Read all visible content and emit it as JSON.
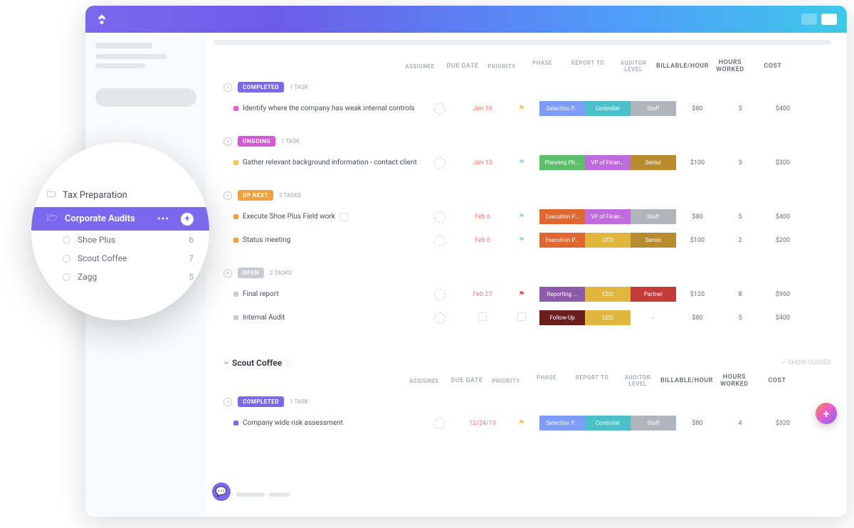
{
  "sidebar_float": {
    "folders": [
      {
        "name": "Tax Preparation"
      },
      {
        "name": "Corporate Audits",
        "active": true,
        "lists": [
          {
            "name": "Shoe Plus",
            "count": 6
          },
          {
            "name": "Scout Coffee",
            "count": 7
          },
          {
            "name": "Zagg",
            "count": 5
          }
        ]
      }
    ]
  },
  "columns": {
    "assignee": "ASSIGNEE",
    "due_date": "DUE DATE",
    "priority": "PRIORITY",
    "phase": "PHASE",
    "report_to": "REPORT TO",
    "auditor_level": "AUDITOR LEVEL",
    "billable_hour": "BILLABLE/HOUR",
    "hours_worked": "HOURS WORKED",
    "cost": "COST"
  },
  "show_closed": "SHOW CLOSED",
  "groups": [
    {
      "status": "COMPLETED",
      "status_color": "#7b68ee",
      "meta": "1 TASK",
      "tasks": [
        {
          "title": "Identify where the company has weak internal controls",
          "priority_dot": "#e65bd6",
          "date": "Jan 10",
          "date_color": "#fd7171",
          "flag": "#f2c94c",
          "phase": "Selection P...",
          "phase_c": "#7c9cf7",
          "report": "Controller",
          "report_c": "#4cc0c8",
          "level": "Staff",
          "level_c": "#b0b4bb",
          "bill": "$80",
          "hours": "5",
          "cost": "$400"
        }
      ]
    },
    {
      "status": "ONGOING",
      "status_color": "#d459d4",
      "meta": "1 TASK",
      "tasks": [
        {
          "title": "Gather relevant background information - contact client",
          "priority_dot": "#f2c94c",
          "date": "Jan 15",
          "date_color": "#fd7171",
          "flag": "#9cd6f4",
          "phase": "Planning Ph...",
          "phase_c": "#5cc06a",
          "report": "VP of Finan...",
          "report_c": "#c06ae0",
          "level": "Senior",
          "level_c": "#b88b2f",
          "bill": "$100",
          "hours": "3",
          "cost": "$300"
        }
      ]
    },
    {
      "status": "UP NEXT",
      "status_color": "#f2a23c",
      "meta": "2 TASKS",
      "tasks": [
        {
          "title": "Execute Shoe Plus Field work",
          "priority_dot": "#f2a23c",
          "date": "Feb 6",
          "date_color": "#fd7171",
          "flag": "#9cd6f4",
          "ghost": true,
          "phase": "Execution P...",
          "phase_c": "#e0672f",
          "report": "VP of Finan...",
          "report_c": "#c06ae0",
          "level": "Staff",
          "level_c": "#b0b4bb",
          "bill": "$80",
          "hours": "5",
          "cost": "$400"
        },
        {
          "title": "Status meeting",
          "priority_dot": "#f2a23c",
          "date": "Feb 6",
          "date_color": "#fd7171",
          "flag": "#9cd6f4",
          "phase": "Execution P...",
          "phase_c": "#e0672f",
          "report": "CFO",
          "report_c": "#e0b63c",
          "level": "Senior",
          "level_c": "#b88b2f",
          "bill": "$100",
          "hours": "2",
          "cost": "$200"
        }
      ]
    },
    {
      "status": "OPEN",
      "status_color": "#c8cbd2",
      "meta": "2 TASKS",
      "tasks": [
        {
          "title": "Final report",
          "priority_dot": "#c8cbd2",
          "date": "Feb 27",
          "date_color": "#fd7171",
          "flag": "#e05555",
          "phase": "Reporting ...",
          "phase_c": "#8b5aa8",
          "report": "CEO",
          "report_c": "#e0b63c",
          "level": "Partner",
          "level_c": "#c23c3c",
          "bill": "$120",
          "hours": "8",
          "cost": "$960"
        },
        {
          "title": "Internal Audit",
          "priority_dot": "#c8cbd2",
          "date": "",
          "date_color": "",
          "flag": "",
          "phase": "Follow-Up",
          "phase_c": "#6b1e1e",
          "report": "CEO",
          "report_c": "#e0b63c",
          "level": "-",
          "level_c": "transparent",
          "bill": "$80",
          "hours": "5",
          "cost": "$400"
        }
      ]
    }
  ],
  "section2": {
    "name": "Scout Coffee",
    "groups": [
      {
        "status": "COMPLETED",
        "status_color": "#7b68ee",
        "meta": "1 TASK",
        "tasks": [
          {
            "title": "Company wide risk assessment",
            "priority_dot": "#7b68ee",
            "date": "12/24/19",
            "date_color": "#fd7171",
            "flag": "#f2c94c",
            "phase": "Selection P...",
            "phase_c": "#7c9cf7",
            "report": "Controller",
            "report_c": "#4cc0c8",
            "level": "Staff",
            "level_c": "#b0b4bb",
            "bill": "$80",
            "hours": "4",
            "cost": "$320"
          }
        ]
      }
    ]
  }
}
